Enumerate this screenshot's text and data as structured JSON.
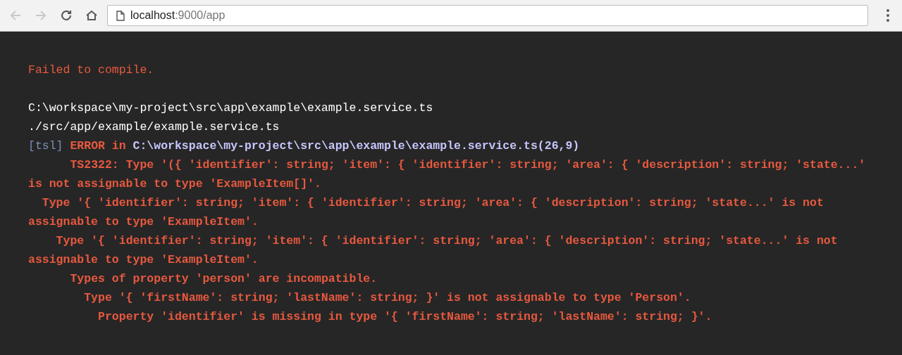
{
  "browser": {
    "back_disabled": true,
    "forward_disabled": true,
    "url_host": "localhost",
    "url_rest": ":9000/app"
  },
  "error_overlay": {
    "title": "Failed to compile.",
    "file_lines": [
      "C:\\workspace\\my-project\\src\\app\\example\\example.service.ts",
      "./src/app/example/example.service.ts"
    ],
    "error_tag": "[tsl]",
    "error_label": "ERROR in",
    "error_location": "C:\\workspace\\my-project\\src\\app\\example\\example.service.ts(26,9)",
    "messages": [
      "      TS2322: Type '({ 'identifier': string; 'item': { 'identifier': string; 'area': { 'description': string; 'state...' is not assignable to type 'ExampleItem[]'.",
      "  Type '{ 'identifier': string; 'item': { 'identifier': string; 'area': { 'description': string; 'state...' is not assignable to type 'ExampleItem'.",
      "    Type '{ 'identifier': string; 'item': { 'identifier': string; 'area': { 'description': string; 'state...' is not assignable to type 'ExampleItem'.",
      "      Types of property 'person' are incompatible.",
      "        Type '{ 'firstName': string; 'lastName': string; }' is not assignable to type 'Person'.",
      "          Property 'identifier' is missing in type '{ 'firstName': string; 'lastName': string; }'."
    ]
  }
}
